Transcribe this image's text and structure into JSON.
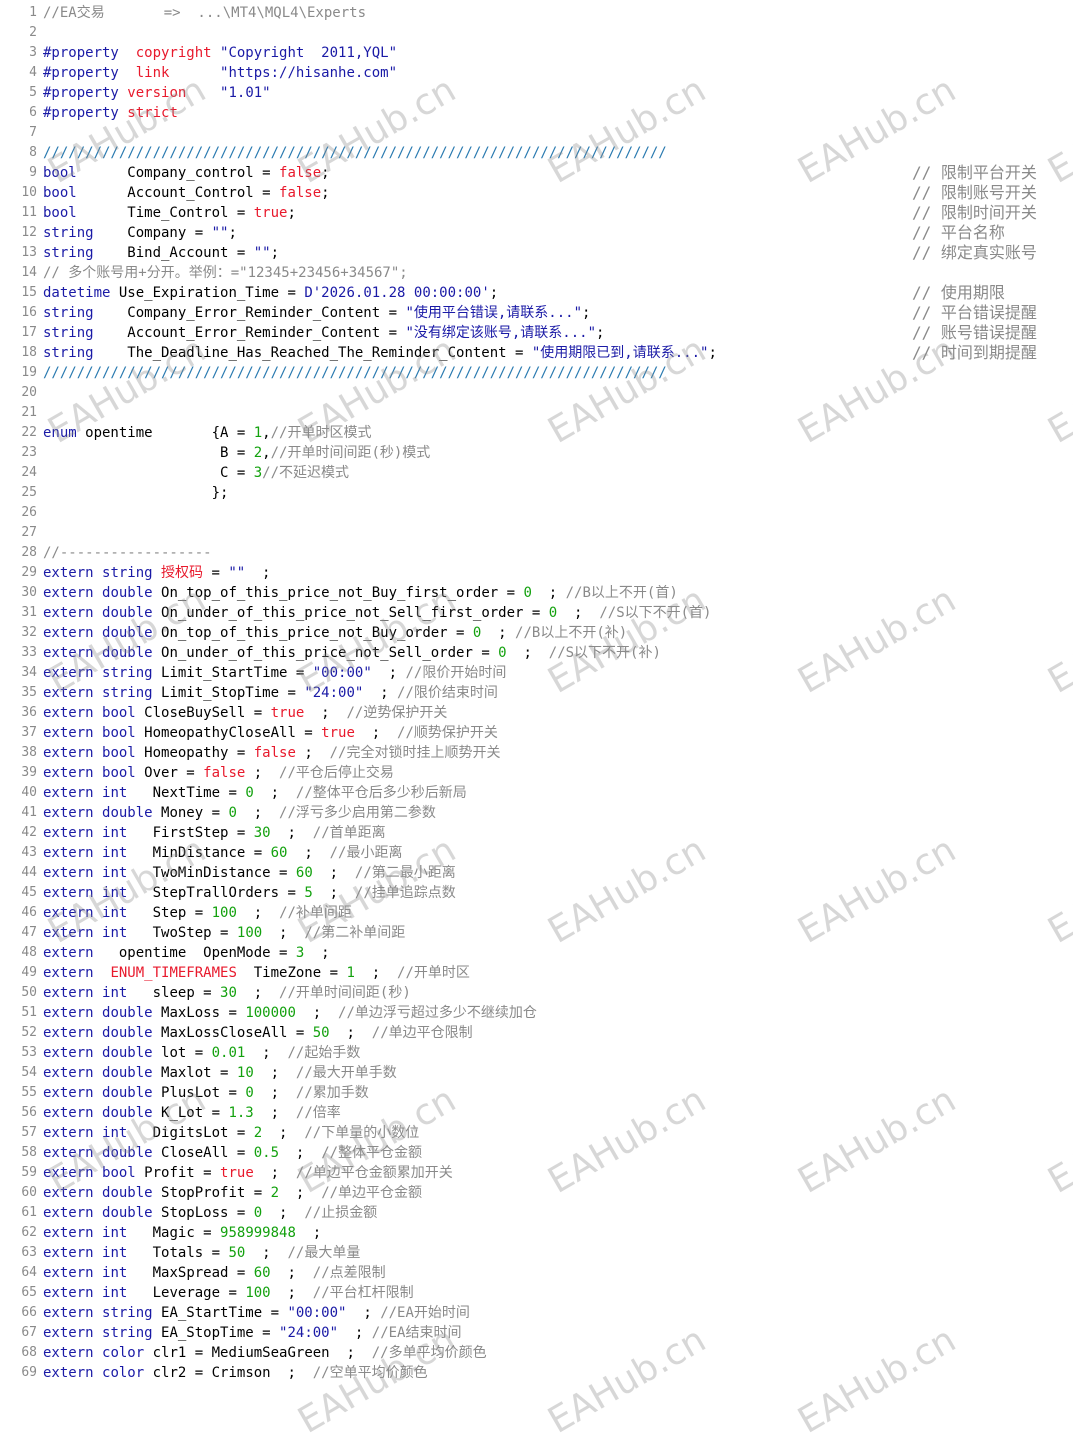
{
  "editor": {
    "lines": [
      {
        "n": "1",
        "t": "//EA交易       =>  ...\\MT4\\MQL4\\Experts"
      },
      {
        "n": "2",
        "t": ""
      },
      {
        "n": "3",
        "t": "#property  copyright \"Copyright  2011,YQL\""
      },
      {
        "n": "4",
        "t": "#property  link      \"https://hisanhe.com\""
      },
      {
        "n": "5",
        "t": "#property version    \"1.01\""
      },
      {
        "n": "6",
        "t": "#property strict"
      },
      {
        "n": "7",
        "t": ""
      },
      {
        "n": "8",
        "t": "//////////////////////////////////////////////////////////////////////////"
      },
      {
        "n": "9",
        "t": "bool      Company_control = false;",
        "c": "// 限制平台开关"
      },
      {
        "n": "10",
        "t": "bool      Account_Control = false;",
        "c": "// 限制账号开关"
      },
      {
        "n": "11",
        "t": "bool      Time_Control = true;",
        "c": "// 限制时间开关"
      },
      {
        "n": "12",
        "t": "string    Company = \"\";",
        "c": "// 平台名称"
      },
      {
        "n": "13",
        "t": "string    Bind_Account = \"\";",
        "c": "// 绑定真实账号"
      },
      {
        "n": "14",
        "t": "// 多个账号用+分开。举例：=\"12345+23456+34567\";"
      },
      {
        "n": "15",
        "t": "datetime Use_Expiration_Time = D'2026.01.28 00:00:00';",
        "c": "// 使用期限"
      },
      {
        "n": "16",
        "t": "string    Company_Error_Reminder_Content = \"使用平台错误,请联系...\";",
        "c": "// 平台错误提醒"
      },
      {
        "n": "17",
        "t": "string    Account_Error_Reminder_Content = \"没有绑定该账号,请联系...\";",
        "c": "// 账号错误提醒"
      },
      {
        "n": "18",
        "t": "string    The_Deadline_Has_Reached_The_Reminder_Content = \"使用期限已到,请联系...\";",
        "c": "// 时间到期提醒"
      },
      {
        "n": "19",
        "t": "//////////////////////////////////////////////////////////////////////////"
      },
      {
        "n": "20",
        "t": ""
      },
      {
        "n": "21",
        "t": ""
      },
      {
        "n": "22",
        "t": "enum opentime       {A = 1,//开单时区模式"
      },
      {
        "n": "23",
        "t": "                     B = 2,//开单时间间距(秒)模式"
      },
      {
        "n": "24",
        "t": "                     C = 3//不延迟模式"
      },
      {
        "n": "25",
        "t": "                    };"
      },
      {
        "n": "26",
        "t": ""
      },
      {
        "n": "27",
        "t": ""
      },
      {
        "n": "28",
        "t": "//------------------"
      },
      {
        "n": "29",
        "t": "extern string 授权码 = \"\"  ;"
      },
      {
        "n": "30",
        "t": "extern double On_top_of_this_price_not_Buy_first_order = 0  ; //B以上不开(首)"
      },
      {
        "n": "31",
        "t": "extern double On_under_of_this_price_not_Sell_first_order = 0  ;  //S以下不开(首)"
      },
      {
        "n": "32",
        "t": "extern double On_top_of_this_price_not_Buy_order = 0  ; //B以上不开(补)"
      },
      {
        "n": "33",
        "t": "extern double On_under_of_this_price_not_Sell_order = 0  ;  //S以下不开(补)"
      },
      {
        "n": "34",
        "t": "extern string Limit_StartTime = \"00:00\"  ; //限价开始时间"
      },
      {
        "n": "35",
        "t": "extern string Limit_StopTime = \"24:00\"  ; //限价结束时间"
      },
      {
        "n": "36",
        "t": "extern bool CloseBuySell = true  ;  //逆势保护开关"
      },
      {
        "n": "37",
        "t": "extern bool HomeopathyCloseAll = true  ;  //顺势保护开关"
      },
      {
        "n": "38",
        "t": "extern bool Homeopathy = false ;  //完全对锁时挂上顺势开关"
      },
      {
        "n": "39",
        "t": "extern bool Over = false ;  //平仓后停止交易"
      },
      {
        "n": "40",
        "t": "extern int   NextTime = 0  ;  //整体平仓后多少秒后新局"
      },
      {
        "n": "41",
        "t": "extern double Money = 0  ;  //浮亏多少启用第二参数"
      },
      {
        "n": "42",
        "t": "extern int   FirstStep = 30  ;  //首单距离"
      },
      {
        "n": "43",
        "t": "extern int   MinDistance = 60  ;  //最小距离"
      },
      {
        "n": "44",
        "t": "extern int   TwoMinDistance = 60  ;  //第二最小距离"
      },
      {
        "n": "45",
        "t": "extern int   StepTrallOrders = 5  ;  //挂单追踪点数"
      },
      {
        "n": "46",
        "t": "extern int   Step = 100  ;  //补单间距"
      },
      {
        "n": "47",
        "t": "extern int   TwoStep = 100  ;  //第二补单间距"
      },
      {
        "n": "48",
        "t": "extern   opentime  OpenMode = 3  ;"
      },
      {
        "n": "49",
        "t": "extern  ENUM_TIMEFRAMES  TimeZone = 1  ;  //开单时区"
      },
      {
        "n": "50",
        "t": "extern int   sleep = 30  ;  //开单时间间距(秒)"
      },
      {
        "n": "51",
        "t": "extern double MaxLoss = 100000  ;  //单边浮亏超过多少不继续加仓"
      },
      {
        "n": "52",
        "t": "extern double MaxLossCloseAll = 50  ;  //单边平仓限制"
      },
      {
        "n": "53",
        "t": "extern double lot = 0.01  ;  //起始手数"
      },
      {
        "n": "54",
        "t": "extern double Maxlot = 10  ;  //最大开单手数"
      },
      {
        "n": "55",
        "t": "extern double PlusLot = 0  ;  //累加手数"
      },
      {
        "n": "56",
        "t": "extern double K_Lot = 1.3  ;  //倍率"
      },
      {
        "n": "57",
        "t": "extern int   DigitsLot = 2  ;  //下单量的小数位"
      },
      {
        "n": "58",
        "t": "extern double CloseAll = 0.5  ;  //整体平仓金额"
      },
      {
        "n": "59",
        "t": "extern bool Profit = true  ;  //单边平仓金额累加开关"
      },
      {
        "n": "60",
        "t": "extern double StopProfit = 2  ;  //单边平仓金额"
      },
      {
        "n": "61",
        "t": "extern double StopLoss = 0  ;  //止损金额"
      },
      {
        "n": "62",
        "t": "extern int   Magic = 958999848  ;"
      },
      {
        "n": "63",
        "t": "extern int   Totals = 50  ;  //最大单量"
      },
      {
        "n": "64",
        "t": "extern int   MaxSpread = 60  ;  //点差限制"
      },
      {
        "n": "65",
        "t": "extern int   Leverage = 100  ;  //平台杠杆限制"
      },
      {
        "n": "66",
        "t": "extern string EA_StartTime = \"00:00\"  ; //EA开始时间"
      },
      {
        "n": "67",
        "t": "extern string EA_StopTime = \"24:00\"  ; //EA结束时间"
      },
      {
        "n": "68",
        "t": "extern color clr1 = MediumSeaGreen  ;  //多单平均价颜色"
      },
      {
        "n": "69",
        "t": "extern color clr2 = Crimson  ;  //空单平均价颜色"
      }
    ]
  },
  "watermark": "EAHub.cn"
}
